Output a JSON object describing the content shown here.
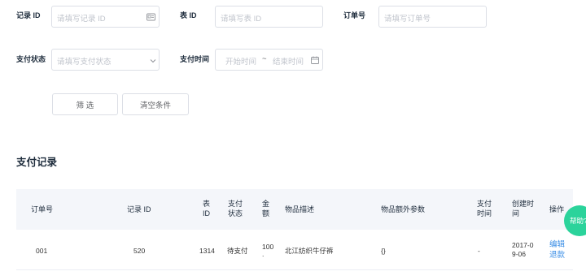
{
  "filters": {
    "record_id": {
      "label": "记录 ID",
      "placeholder": "请填写记录 ID"
    },
    "table_id": {
      "label": "表 ID",
      "placeholder": "请填写表 ID"
    },
    "order_no": {
      "label": "订单号",
      "placeholder": "请填写订单号"
    },
    "pay_status": {
      "label": "支付状态",
      "placeholder": "请填写支付状态"
    },
    "pay_time": {
      "label": "支付时间",
      "start_placeholder": "开始时间",
      "separator": "~",
      "end_placeholder": "结束时间"
    },
    "filter_button": "筛 选",
    "clear_button": "清空条件"
  },
  "section_title": "支付记录",
  "table": {
    "headers": {
      "order_no": "订单号",
      "record_id": "记录 ID",
      "table_id": [
        "表",
        "ID"
      ],
      "pay_status": [
        "支付",
        "状态"
      ],
      "amount": [
        "金",
        "额"
      ],
      "item_desc": "物品描述",
      "extra_params": "物品额外参数",
      "pay_time": [
        "支付",
        "时间"
      ],
      "created_time": [
        "创建时",
        "间"
      ],
      "actions": "操作"
    },
    "rows": [
      {
        "order_no": "001",
        "record_id": "520",
        "table_id": "1314",
        "pay_status": "待支付",
        "amount": [
          "100",
          "."
        ],
        "item_desc": "北江纺织牛仔裤",
        "extra_params": "{}",
        "pay_time": "-",
        "created_time": [
          "2017-0",
          "9-06"
        ],
        "actions": [
          "编辑",
          "退款"
        ]
      }
    ]
  },
  "help_button": "帮助?",
  "colors": {
    "accent": "#3a8ee6",
    "help": "#2bd39b",
    "header_bg": "#f4f6fa",
    "border": "#dcdfe6"
  },
  "icons": {
    "record_id_input": "id-card-icon",
    "pay_status_input": "chevron-down-icon",
    "pay_time_input": "calendar-icon"
  }
}
